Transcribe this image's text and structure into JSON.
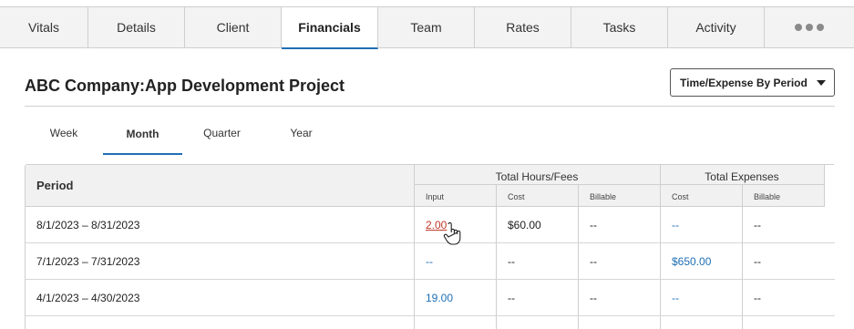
{
  "tabs": [
    "Vitals",
    "Details",
    "Client",
    "Financials",
    "Team",
    "Rates",
    "Tasks",
    "Activity"
  ],
  "active_tab": "Financials",
  "title": "ABC Company:App Development Project",
  "view_select": {
    "value": "Time/Expense By Period"
  },
  "subtabs": [
    "Week",
    "Month",
    "Quarter",
    "Year"
  ],
  "active_subtab": "Month",
  "table": {
    "period_header": "Period",
    "group_hours": "Total Hours/Fees",
    "group_expenses": "Total Expenses",
    "sub_input": "Input",
    "sub_cost": "Cost",
    "sub_billable": "Billable",
    "sub_exp_cost": "Cost",
    "sub_exp_billable": "Billable",
    "rows": [
      {
        "period": "8/1/2023 – 8/31/2023",
        "input": "2.00",
        "cost": "$60.00",
        "billable": "--",
        "exp_cost": "--",
        "exp_billable": "--"
      },
      {
        "period": "7/1/2023 – 7/31/2023",
        "input": "--",
        "cost": "--",
        "billable": "--",
        "exp_cost": "$650.00",
        "exp_billable": "--"
      },
      {
        "period": "4/1/2023 – 4/30/2023",
        "input": "19.00",
        "cost": "--",
        "billable": "--",
        "exp_cost": "--",
        "exp_billable": "--"
      }
    ]
  },
  "colors": {
    "accent": "#1f6fb5",
    "hover_link": "#c0392b"
  }
}
